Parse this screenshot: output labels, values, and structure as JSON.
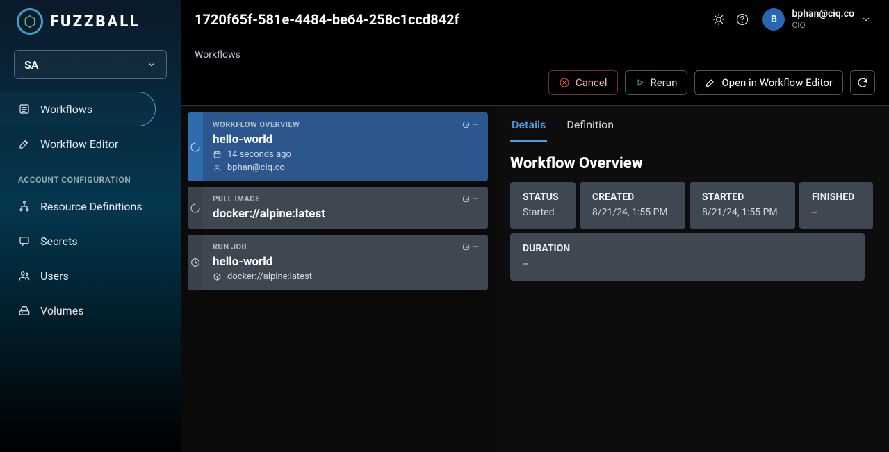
{
  "brand": {
    "name": "FUZZBALL"
  },
  "org_selector": {
    "label": "SA"
  },
  "sidebar": {
    "items": [
      {
        "label": "Workflows"
      },
      {
        "label": "Workflow Editor"
      }
    ],
    "section_label": "ACCOUNT CONFIGURATION",
    "config_items": [
      {
        "label": "Resource Definitions"
      },
      {
        "label": "Secrets"
      },
      {
        "label": "Users"
      },
      {
        "label": "Volumes"
      }
    ]
  },
  "header": {
    "title": "1720f65f-581e-4484-be64-258c1ccd842f"
  },
  "user": {
    "avatar_letter": "B",
    "email": "bphan@ciq.co",
    "org": "CIQ"
  },
  "breadcrumb": "Workflows",
  "actions": {
    "cancel": "Cancel",
    "rerun": "Rerun",
    "open_editor": "Open in Workflow Editor"
  },
  "steps": [
    {
      "kicker": "WORKFLOW OVERVIEW",
      "title": "hello-world",
      "duration": "--",
      "meta1": "14 seconds ago",
      "meta2": "bphan@ciq.co",
      "selected": true,
      "icon": "spinner"
    },
    {
      "kicker": "PULL IMAGE",
      "title": "docker://alpine:latest",
      "duration": "--",
      "meta1": "",
      "meta2": "",
      "selected": false,
      "icon": "spinner"
    },
    {
      "kicker": "RUN JOB",
      "title": "hello-world",
      "duration": "--",
      "meta1": "docker://alpine:latest",
      "meta2": "",
      "selected": false,
      "icon": "clock",
      "meta1_icon": "cube"
    }
  ],
  "tabs": [
    {
      "label": "Details",
      "active": true
    },
    {
      "label": "Definition",
      "active": false
    }
  ],
  "details": {
    "title": "Workflow Overview",
    "stats": {
      "status_label": "STATUS",
      "status_value": "Started",
      "created_label": "CREATED",
      "created_value": "8/21/24, 1:55 PM",
      "started_label": "STARTED",
      "started_value": "8/21/24, 1:55 PM",
      "finished_label": "FINISHED",
      "finished_value": "--",
      "duration_label": "DURATION",
      "duration_value": "--"
    }
  }
}
